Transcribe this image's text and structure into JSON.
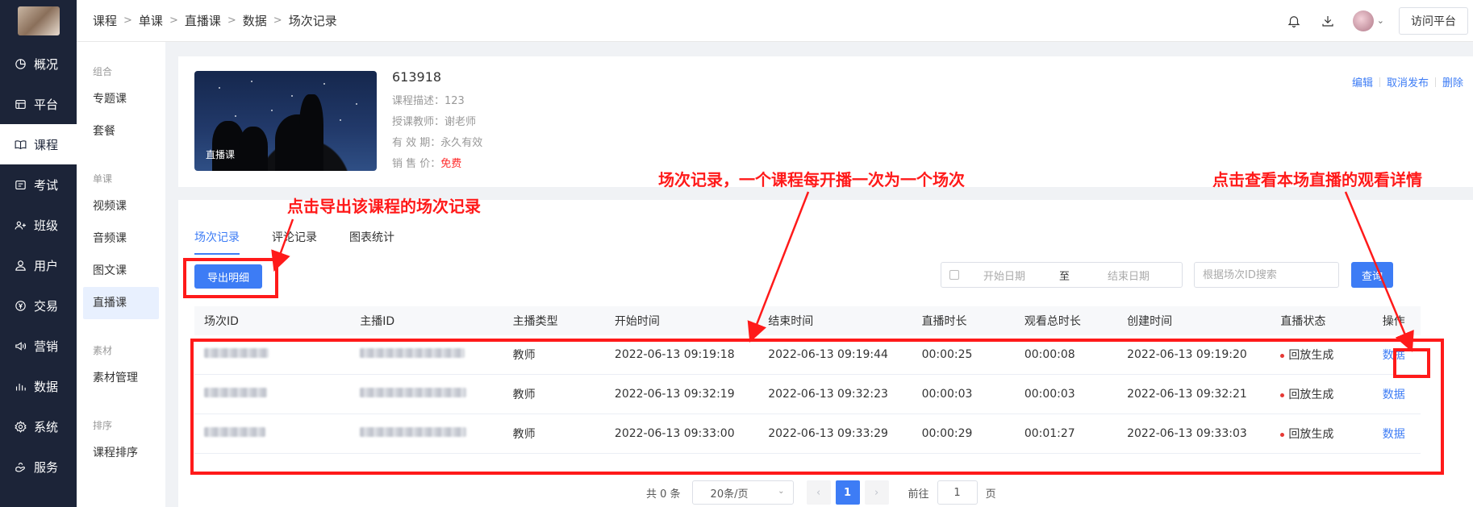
{
  "nav": {
    "items": [
      {
        "label": "概况",
        "icon": "dashboard-icon"
      },
      {
        "label": "平台",
        "icon": "platform-icon"
      },
      {
        "label": "课程",
        "icon": "book-icon"
      },
      {
        "label": "考试",
        "icon": "exam-icon"
      },
      {
        "label": "班级",
        "icon": "class-icon"
      },
      {
        "label": "用户",
        "icon": "user-icon"
      },
      {
        "label": "交易",
        "icon": "yen-icon"
      },
      {
        "label": "营销",
        "icon": "megaphone-icon"
      },
      {
        "label": "数据",
        "icon": "bar-chart-icon"
      },
      {
        "label": "系统",
        "icon": "gear-icon"
      },
      {
        "label": "服务",
        "icon": "service-icon"
      }
    ],
    "active": "课程"
  },
  "submenu": {
    "groups": [
      {
        "title": "组合",
        "items": [
          "专题课",
          "套餐"
        ]
      },
      {
        "title": "单课",
        "items": [
          "视频课",
          "音频课",
          "图文课",
          "直播课"
        ]
      },
      {
        "title": "素材",
        "items": [
          "素材管理"
        ]
      },
      {
        "title": "排序",
        "items": [
          "课程排序"
        ]
      }
    ],
    "active": "直播课"
  },
  "header": {
    "breadcrumb": [
      "课程",
      "单课",
      "直播课",
      "数据",
      "场次记录"
    ],
    "visit_label": "访问平台"
  },
  "course": {
    "cover_tag": "直播课",
    "title": "613918",
    "desc_label": "课程描述：",
    "desc": "123",
    "teacher_label": "授课教师：",
    "teacher": "谢老师",
    "valid_label": "有 效 期：",
    "valid": "永久有效",
    "price_label": "销 售 价：",
    "price": "免费",
    "actions": [
      "编辑",
      "取消发布",
      "删除"
    ]
  },
  "tabs": [
    "场次记录",
    "评论记录",
    "图表统计"
  ],
  "toolbar": {
    "export_label": "导出明细",
    "start_placeholder": "开始日期",
    "to_label": "至",
    "end_placeholder": "结束日期",
    "search_placeholder": "根据场次ID搜索",
    "query_label": "查询"
  },
  "table": {
    "columns": [
      "场次ID",
      "主播ID",
      "主播类型",
      "开始时间",
      "结束时间",
      "直播时长",
      "观看总时长",
      "创建时间",
      "直播状态",
      "操作"
    ],
    "rows": [
      {
        "anchor_type": "教师",
        "start": "2022-06-13 09:19:18",
        "end": "2022-06-13 09:19:44",
        "duration": "00:00:25",
        "watch": "00:00:08",
        "created": "2022-06-13 09:19:20",
        "status": "回放生成",
        "action": "数据"
      },
      {
        "anchor_type": "教师",
        "start": "2022-06-13 09:32:19",
        "end": "2022-06-13 09:32:23",
        "duration": "00:00:03",
        "watch": "00:00:03",
        "created": "2022-06-13 09:32:21",
        "status": "回放生成",
        "action": "数据"
      },
      {
        "anchor_type": "教师",
        "start": "2022-06-13 09:33:00",
        "end": "2022-06-13 09:33:29",
        "duration": "00:00:29",
        "watch": "00:01:27",
        "created": "2022-06-13 09:33:03",
        "status": "回放生成",
        "action": "数据"
      }
    ]
  },
  "pagination": {
    "total": "共 0 条",
    "page_size": "20条/页",
    "current_page": "1",
    "goto_label": "前往",
    "goto_value": "1",
    "page_unit": "页"
  },
  "annotations": {
    "export": "点击导出该课程的场次记录",
    "records": "场次记录，一个课程每开播一次为一个场次",
    "detail": "点击查看本场直播的观看详情"
  },
  "colors": {
    "accent": "#3d7cf5",
    "nav_bg": "#1c2438",
    "annotation": "#ff1a1a",
    "price_free": "#ff2a2a"
  }
}
